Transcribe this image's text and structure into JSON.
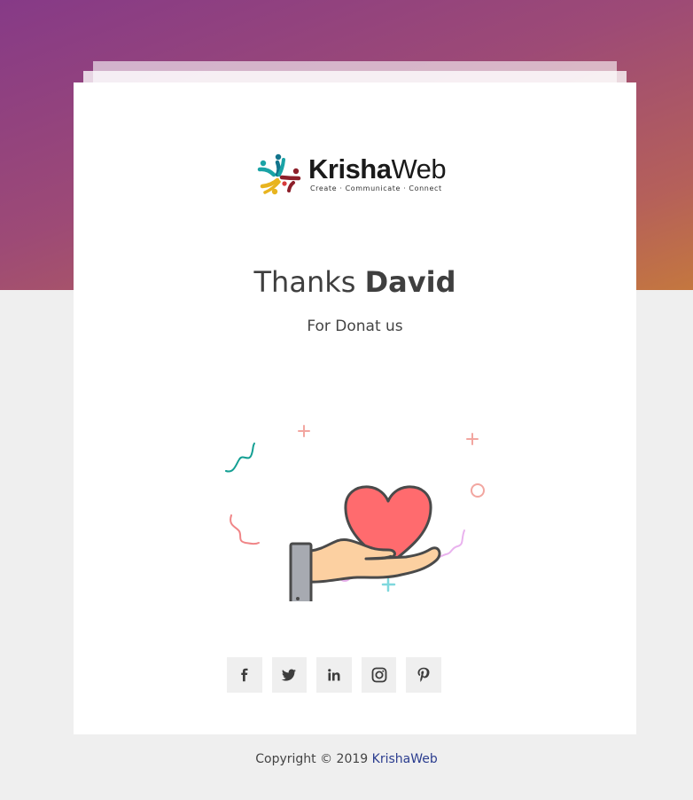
{
  "logo": {
    "word_part1": "Krisha",
    "word_part2": "Web",
    "tagline": "Create · Communicate · Connect"
  },
  "greeting": {
    "prefix": "Thanks",
    "name": "David",
    "message": "For Donat us"
  },
  "illustration": {
    "icon": "heart-in-hand-icon",
    "heart_color": "#ff6b6e",
    "hand_color": "#fcd0a1",
    "cuff_color": "#a7aab1"
  },
  "social_links": [
    {
      "name": "facebook",
      "icon": "facebook-icon"
    },
    {
      "name": "twitter",
      "icon": "twitter-icon"
    },
    {
      "name": "linkedin",
      "icon": "linkedin-icon"
    },
    {
      "name": "instagram",
      "icon": "instagram-icon"
    },
    {
      "name": "pinterest",
      "icon": "pinterest-icon"
    }
  ],
  "footer": {
    "copyright_text": "Copyright © 2019",
    "brand": "KrishaWeb"
  },
  "colors": {
    "gradient_start": "#863a87",
    "gradient_end": "#c4773f",
    "page_background": "#efefef",
    "card_background": "#ffffff",
    "brand_link": "#2b3d8f"
  }
}
